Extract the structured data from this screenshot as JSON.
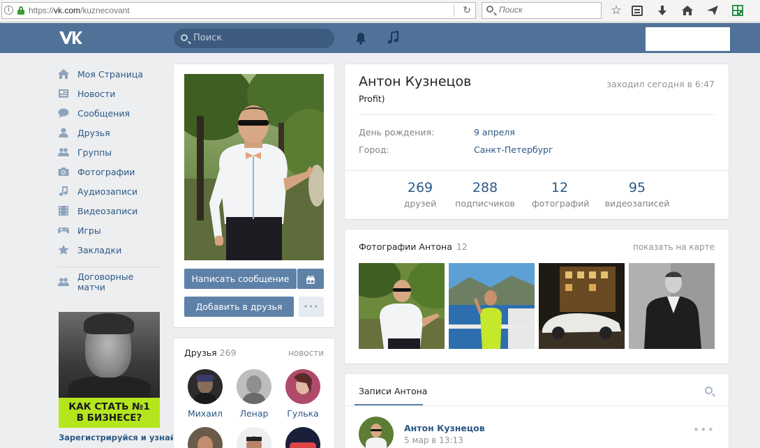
{
  "browser": {
    "url_prefix": "https://",
    "url_host": "vk.com",
    "url_path": "/kuznecovant",
    "search_placeholder": "Поиск"
  },
  "header": {
    "search_placeholder": "Поиск"
  },
  "menu": {
    "items": [
      {
        "label": "Моя Страница",
        "icon": "home-icon"
      },
      {
        "label": "Новости",
        "icon": "news-icon"
      },
      {
        "label": "Сообщения",
        "icon": "messages-icon"
      },
      {
        "label": "Друзья",
        "icon": "friends-icon"
      },
      {
        "label": "Группы",
        "icon": "groups-icon"
      },
      {
        "label": "Фотографии",
        "icon": "camera-icon"
      },
      {
        "label": "Аудиозаписи",
        "icon": "music-icon"
      },
      {
        "label": "Видеозаписи",
        "icon": "video-icon"
      },
      {
        "label": "Игры",
        "icon": "gamepad-icon"
      },
      {
        "label": "Закладки",
        "icon": "star-icon"
      }
    ],
    "extra": {
      "label": "Договорные матчи",
      "icon": "groups-icon"
    }
  },
  "ad": {
    "banner_line1": "КАК СТАТЬ №1",
    "banner_line2": "В БИЗНЕСЕ?",
    "caption": "Зарегистрируйся и узнай!"
  },
  "profile": {
    "name": "Антон Кузнецов",
    "status": "Profit)",
    "last_seen": "заходил сегодня в 6:47",
    "birthday_label": "День рождения:",
    "birthday_value": "9 апреля",
    "city_label": "Город:",
    "city_value": "Санкт-Петербург",
    "counters": [
      {
        "value": "269",
        "label": "друзей"
      },
      {
        "value": "288",
        "label": "подписчиков"
      },
      {
        "value": "12",
        "label": "фотографий"
      },
      {
        "value": "95",
        "label": "видеозаписей"
      }
    ],
    "btn_message": "Написать сообщение",
    "btn_add": "Добавить в друзья",
    "btn_more": "•••"
  },
  "friends": {
    "title": "Друзья",
    "count": "269",
    "link": "новости",
    "list": [
      {
        "name": "Михаил"
      },
      {
        "name": "Ленар"
      },
      {
        "name": "Гулька"
      }
    ]
  },
  "photos": {
    "title": "Фотографии Антона",
    "count": "12",
    "link": "показать на карте"
  },
  "wall": {
    "tab": "Записи Антона",
    "post_author": "Антон Кузнецов",
    "post_date": "5 мар в 13:13",
    "post_more": "•••"
  },
  "colors": {
    "vk_header": "#507299",
    "link": "#2a5885",
    "button": "#5e81a8",
    "ad_banner": "#b4e61e"
  }
}
